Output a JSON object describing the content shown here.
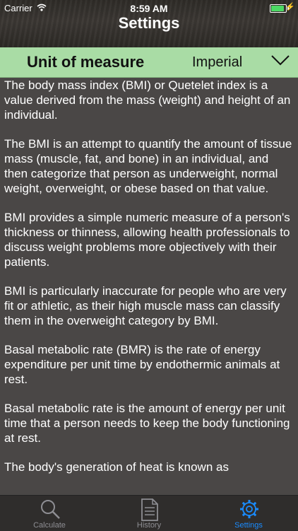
{
  "status_bar": {
    "carrier": "Carrier",
    "time": "8:59 AM",
    "battery_level": 0.9
  },
  "header": {
    "title": "Settings"
  },
  "unit": {
    "label": "Unit of measure",
    "value": "Imperial"
  },
  "paragraphs": [
    "The body mass index (BMI) or Quetelet index is a value derived from the mass (weight) and height of an individual.",
    "The BMI is an attempt to quantify the amount of tissue mass (muscle, fat, and bone) in an individual, and then categorize that person as underweight, normal weight, overweight, or obese based on that value.",
    "BMI provides a simple numeric measure of a person's thickness or thinness, allowing health professionals to discuss weight problems more objectively with their patients.",
    "BMI is particularly inaccurate for people who are very fit or athletic, as their high muscle mass can classify them in the overweight category by BMI.",
    "Basal metabolic rate (BMR) is the rate of energy expenditure per unit time by endothermic animals at rest.",
    "Basal metabolic rate is the amount of energy per unit time that a person needs to keep the body functioning at rest.",
    "The body's generation of heat is known as"
  ],
  "tabs": [
    {
      "label": "Calculate",
      "icon": "magnifier-icon"
    },
    {
      "label": "History",
      "icon": "document-icon"
    },
    {
      "label": "Settings",
      "icon": "gear-icon",
      "active": true
    }
  ],
  "colors": {
    "accent": "#1a8cff",
    "unit_bar": "#a9dca5",
    "content_bg": "#4a4746",
    "battery": "#4cd964"
  }
}
